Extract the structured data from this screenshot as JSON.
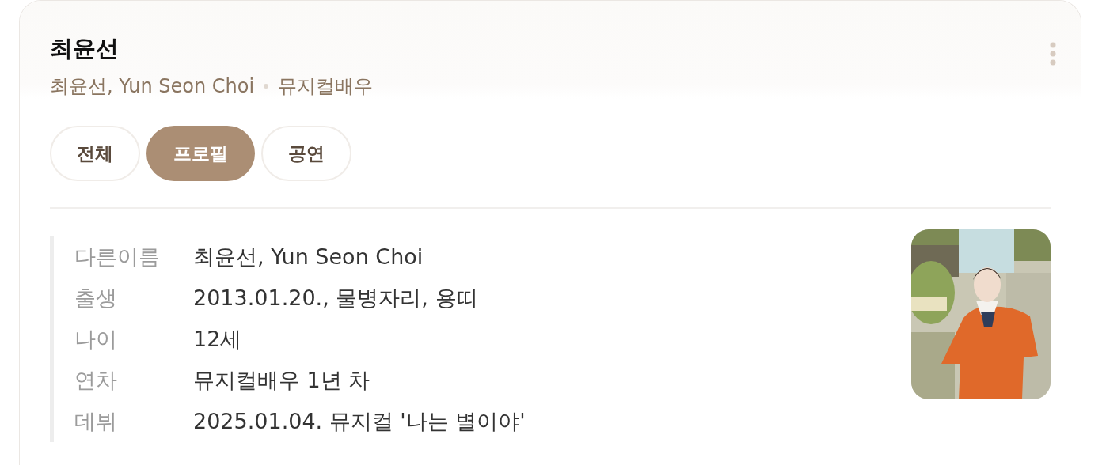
{
  "header": {
    "title": "최윤선",
    "subtitle": "최윤선, Yun Seon Choi",
    "occupation": "뮤지컬배우"
  },
  "tabs": [
    {
      "label": "전체",
      "selected": false
    },
    {
      "label": "프로필",
      "selected": true
    },
    {
      "label": "공연",
      "selected": false
    }
  ],
  "profile": {
    "rows": [
      {
        "label": "다른이름",
        "value": "최윤선, Yun Seon Choi"
      },
      {
        "label": "출생",
        "value": "2013.01.20., 물병자리, 용띠"
      },
      {
        "label": "나이",
        "value": "12세"
      },
      {
        "label": "연차",
        "value": "뮤지컬배우 1년 차"
      },
      {
        "label": "데뷔",
        "value": "2025.01.04. 뮤지컬 '나는 별이야'"
      }
    ]
  }
}
